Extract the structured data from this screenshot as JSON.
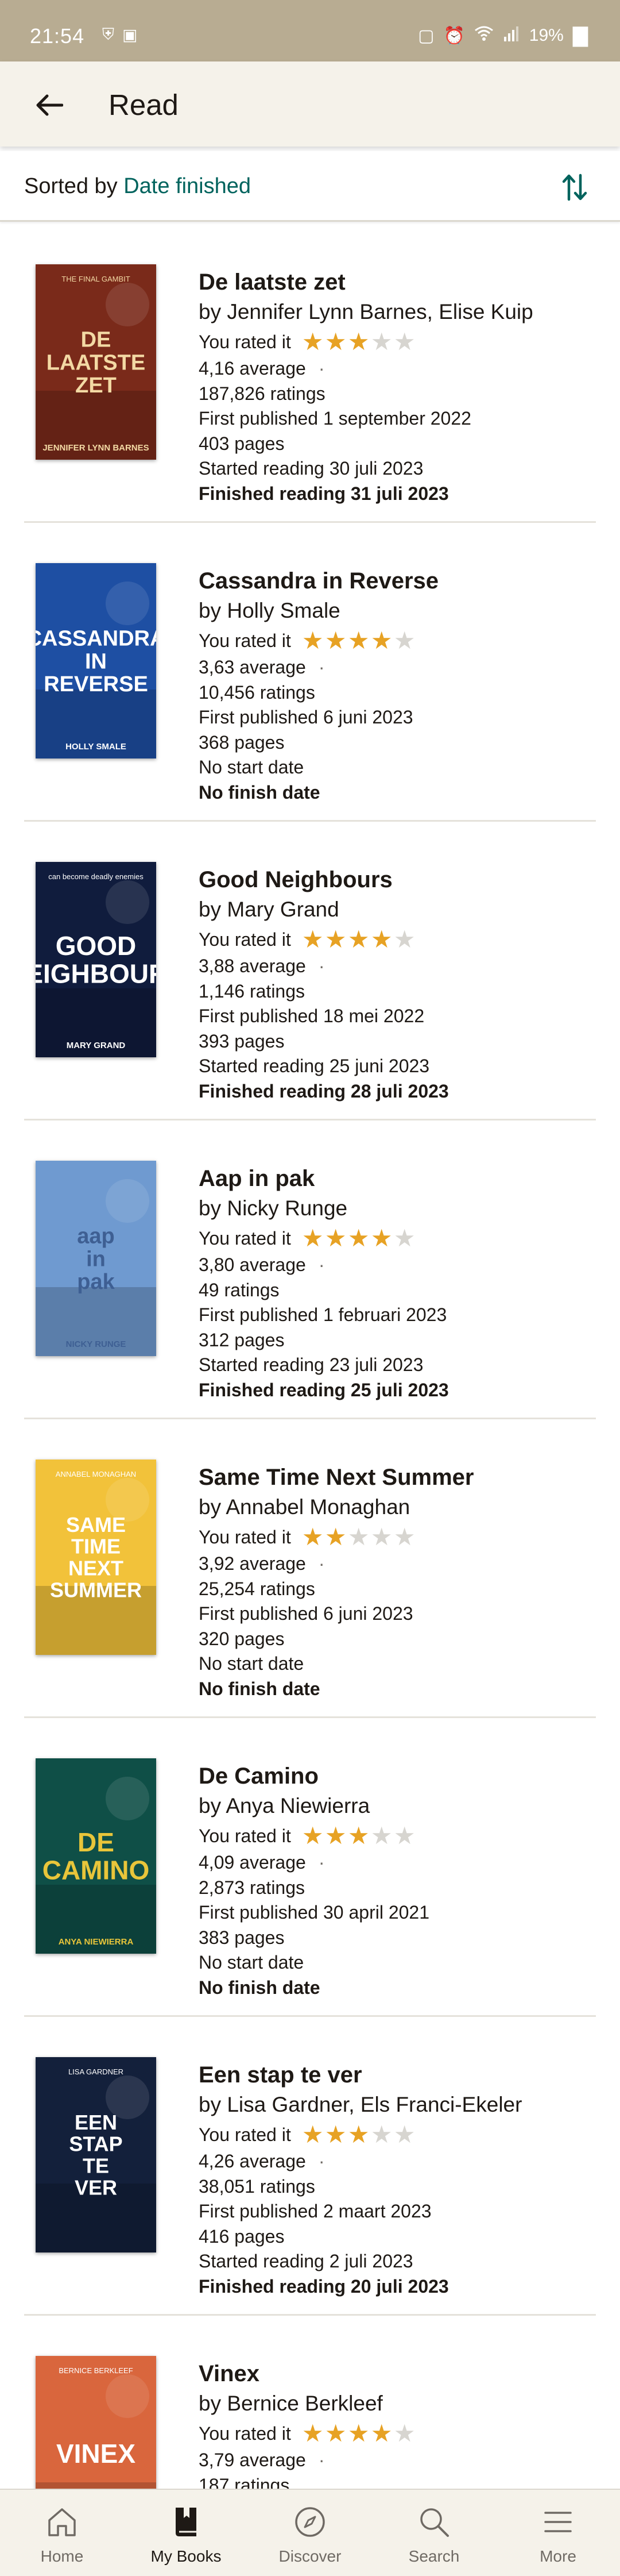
{
  "status_bar": {
    "time": "21:54",
    "left_icons": [
      "shield-icon",
      "image-icon"
    ],
    "right_icons": [
      "nfc-icon",
      "alarm-icon",
      "wifi-icon",
      "signal-icon"
    ],
    "battery": "19%"
  },
  "app_bar": {
    "title": "Read",
    "back_icon": "arrow-left-icon"
  },
  "sort": {
    "label": "Sorted by",
    "value": "Date finished",
    "toggle_icon": "sort-arrows-icon"
  },
  "colors": {
    "accent": "#00635d",
    "star": "#e7a224",
    "star_empty": "#d7d5d0",
    "bar": "#f5f2ea"
  },
  "books": [
    {
      "title": "De laatste zet",
      "author": "by Jennifer Lynn Barnes, Elise Kuip",
      "rated_label": "You rated it",
      "rating": 3,
      "average": "4,16 average",
      "ratings": "187,826 ratings",
      "published": "First published 1 september 2022",
      "pages": "403 pages",
      "started": "Started reading 30 juli 2023",
      "finished": "Finished reading 31 juli 2023",
      "cover": {
        "bg": "#7a2a1a",
        "fg": "#f3d9a4",
        "lines": [
          "DE",
          "LAATSTE",
          "ZET"
        ],
        "small_top": "THE FINAL GAMBIT",
        "small_bottom": "JENNIFER LYNN BARNES"
      }
    },
    {
      "title": "Cassandra in Reverse",
      "author": "by Holly Smale",
      "rated_label": "You rated it",
      "rating": 4,
      "average": "3,63 average",
      "ratings": "10,456 ratings",
      "published": "First published 6 juni 2023",
      "pages": "368 pages",
      "started": "No start date",
      "finished": "No finish date",
      "cover": {
        "bg": "#1e4fa3",
        "fg": "#ffffff",
        "lines": [
          "CASSANDRA",
          "IN",
          "REVERSE"
        ],
        "small_top": "",
        "small_bottom": "HOLLY SMALE"
      }
    },
    {
      "title": "Good Neighbours",
      "author": "by Mary Grand",
      "rated_label": "You rated it",
      "rating": 4,
      "average": "3,88 average",
      "ratings": "1,146 ratings",
      "published": "First published 18 mei 2022",
      "pages": "393 pages",
      "started": "Started reading 25 juni 2023",
      "finished": "Finished reading 28 juli 2023",
      "cover": {
        "bg": "#101c3d",
        "fg": "#ffffff",
        "lines": [
          "GOOD",
          "NEIGHBOURS"
        ],
        "small_top": "can become deadly enemies",
        "small_bottom": "MARY GRAND"
      }
    },
    {
      "title": "Aap in pak",
      "author": "by Nicky Runge",
      "rated_label": "You rated it",
      "rating": 4,
      "average": "3,80 average",
      "ratings": "49 ratings",
      "published": "First published 1 februari 2023",
      "pages": "312 pages",
      "started": "Started reading 23 juli 2023",
      "finished": "Finished reading 25 juli 2023",
      "cover": {
        "bg": "#6f9ad0",
        "fg": "#3e5f93",
        "lines": [
          "aap",
          "in",
          "pak"
        ],
        "small_top": "",
        "small_bottom": "NICKY RUNGE"
      }
    },
    {
      "title": "Same Time Next Summer",
      "author": "by Annabel Monaghan",
      "rated_label": "You rated it",
      "rating": 2,
      "average": "3,92 average",
      "ratings": "25,254 ratings",
      "published": "First published 6 juni 2023",
      "pages": "320 pages",
      "started": "No start date",
      "finished": "No finish date",
      "cover": {
        "bg": "#f2c23a",
        "fg": "#ffffff",
        "lines": [
          "SAME",
          "TIME",
          "NEXT",
          "SUMMER"
        ],
        "small_top": "ANNABEL MONAGHAN",
        "small_bottom": ""
      }
    },
    {
      "title": "De Camino",
      "author": "by Anya Niewierra",
      "rated_label": "You rated it",
      "rating": 3,
      "average": "4,09 average",
      "ratings": "2,873 ratings",
      "published": "First published 30 april 2021",
      "pages": "383 pages",
      "started": "No start date",
      "finished": "No finish date",
      "cover": {
        "bg": "#0f4f47",
        "fg": "#e8c53a",
        "lines": [
          "DE",
          "CAMINO"
        ],
        "small_top": "",
        "small_bottom": "ANYA NIEWIERRA"
      }
    },
    {
      "title": "Een stap te ver",
      "author": "by Lisa Gardner, Els Franci-Ekeler",
      "rated_label": "You rated it",
      "rating": 3,
      "average": "4,26 average",
      "ratings": "38,051 ratings",
      "published": "First published 2 maart 2023",
      "pages": "416 pages",
      "started": "Started reading 2 juli 2023",
      "finished": "Finished reading 20 juli 2023",
      "cover": {
        "bg": "#13203b",
        "fg": "#ffffff",
        "lines": [
          "EEN",
          "STAP",
          "TE",
          "VER"
        ],
        "small_top": "LISA GARDNER",
        "small_bottom": ""
      }
    },
    {
      "title": "Vinex",
      "author": "by Bernice Berkleef",
      "rated_label": "You rated it",
      "rating": 4,
      "average": "3,79 average",
      "ratings": "187 ratings",
      "published": "",
      "pages": "",
      "started": "",
      "finished": "",
      "cover": {
        "bg": "#d9663d",
        "fg": "#ffffff",
        "lines": [
          "VINEX"
        ],
        "small_top": "BERNICE BERKLEEF",
        "small_bottom": ""
      }
    }
  ],
  "bottom_nav": [
    {
      "label": "Home",
      "icon": "home-icon",
      "active": false
    },
    {
      "label": "My Books",
      "icon": "my-books-icon",
      "active": true
    },
    {
      "label": "Discover",
      "icon": "compass-icon",
      "active": false
    },
    {
      "label": "Search",
      "icon": "search-icon",
      "active": false
    },
    {
      "label": "More",
      "icon": "menu-icon",
      "active": false
    }
  ]
}
